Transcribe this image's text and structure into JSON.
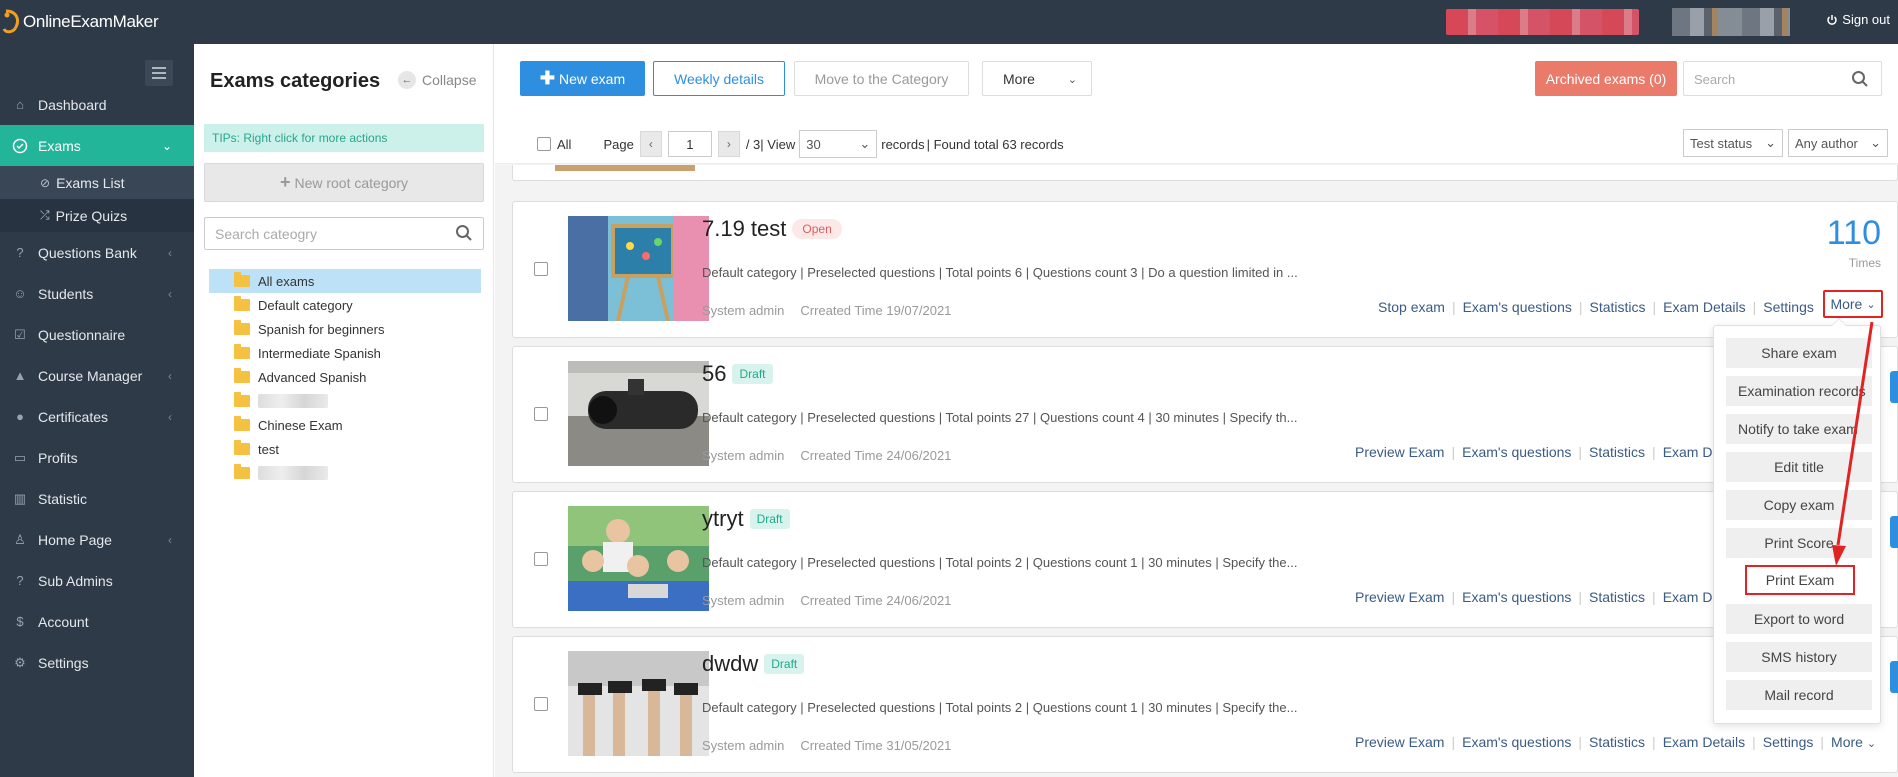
{
  "app": {
    "name": "OnlineExamMaker",
    "signout": "Sign out"
  },
  "sidebar": {
    "items": [
      {
        "label": "Dashboard",
        "icon": "home-icon"
      },
      {
        "label": "Exams",
        "icon": "check-circle-icon"
      },
      {
        "label": "Questions Bank",
        "icon": "question-circle-icon"
      },
      {
        "label": "Students",
        "icon": "user-icon"
      },
      {
        "label": "Questionnaire",
        "icon": "checkbox-icon"
      },
      {
        "label": "Course Manager",
        "icon": "graduation-cap-icon"
      },
      {
        "label": "Certificates",
        "icon": "certificate-icon"
      },
      {
        "label": "Profits",
        "icon": "credit-card-icon"
      },
      {
        "label": "Statistic",
        "icon": "bar-chart-icon"
      },
      {
        "label": "Home Page",
        "icon": "sitemap-icon"
      },
      {
        "label": "Sub Admins",
        "icon": "question-circle-icon"
      },
      {
        "label": "Account",
        "icon": "dollar-icon"
      },
      {
        "label": "Settings",
        "icon": "gear-icon"
      }
    ],
    "exam_sub": [
      {
        "label": "Exams List",
        "icon": "check-circle-icon"
      },
      {
        "label": "Prize Quizs",
        "icon": "shuffle-icon"
      }
    ]
  },
  "categories": {
    "title": "Exams categories",
    "collapse": "Collapse",
    "tips": "TIPs:  Right click for more actions",
    "new_root": "New root category",
    "search_placeholder": "Search cateogry",
    "tree": [
      "All exams",
      "Default category",
      "Spanish for beginners",
      "Intermediate Spanish",
      "Advanced Spanish",
      "",
      "Chinese Exam",
      "test",
      ""
    ]
  },
  "toolbar": {
    "new_exam": "New exam",
    "weekly": "Weekly details",
    "move": "Move to the Category",
    "more": "More",
    "archived": "Archived exams (0)",
    "search_placeholder": "Search"
  },
  "pager": {
    "all": "All",
    "page": "Page",
    "current": "1",
    "total": "/ 3",
    "view": "| View",
    "per_page": "30",
    "records": "records",
    "found": "| Found total 63 records",
    "test_status": "Test status",
    "any_author": "Any author"
  },
  "exams": [
    {
      "title": "7.19 test",
      "status": "Open",
      "desc": "Default category | Preselected questions | Total points 6 | Questions count 3 | Do a question limited in ...",
      "author": "System admin",
      "created": "Crreated Time 19/07/2021",
      "actions": [
        "Stop exam",
        "Exam's questions",
        "Statistics",
        "Exam Details",
        "Settings"
      ],
      "more": "More",
      "count": "110",
      "count_label": "Times"
    },
    {
      "title": "56",
      "status": "Draft",
      "desc": "Default category | Preselected questions | Total points 27 | Questions count 4 | 30 minutes | Specify th...",
      "author": "System admin",
      "created": "Crreated Time 24/06/2021",
      "actions": [
        "Preview Exam",
        "Exam's questions",
        "Statistics",
        "Exam De"
      ]
    },
    {
      "title": "ytryt",
      "status": "Draft",
      "desc": "Default category | Preselected questions | Total points 2 | Questions count 1 | 30 minutes | Specify the...",
      "author": "System admin",
      "created": "Crreated Time 24/06/2021",
      "actions": [
        "Preview Exam",
        "Exam's questions",
        "Statistics",
        "Exam De"
      ]
    },
    {
      "title": "dwdw",
      "status": "Draft",
      "desc": "Default category | Preselected questions | Total points 2 | Questions count 1 | 30 minutes | Specify the...",
      "author": "System admin",
      "created": "Crreated Time 31/05/2021",
      "actions": [
        "Preview Exam",
        "Exam's questions",
        "Statistics",
        "Exam Details",
        "Settings"
      ],
      "more": "More"
    }
  ],
  "dropdown": [
    "Share exam",
    "Examination records",
    "Notify to take exam",
    "Edit title",
    "Copy exam",
    "Print Score",
    "Print Exam",
    "Export to word",
    "SMS history",
    "Mail record"
  ],
  "colors": {
    "accent": "#2e8fe0",
    "active": "#22b59a",
    "highlight": "#e02424",
    "sidebar": "#2e3a48"
  }
}
